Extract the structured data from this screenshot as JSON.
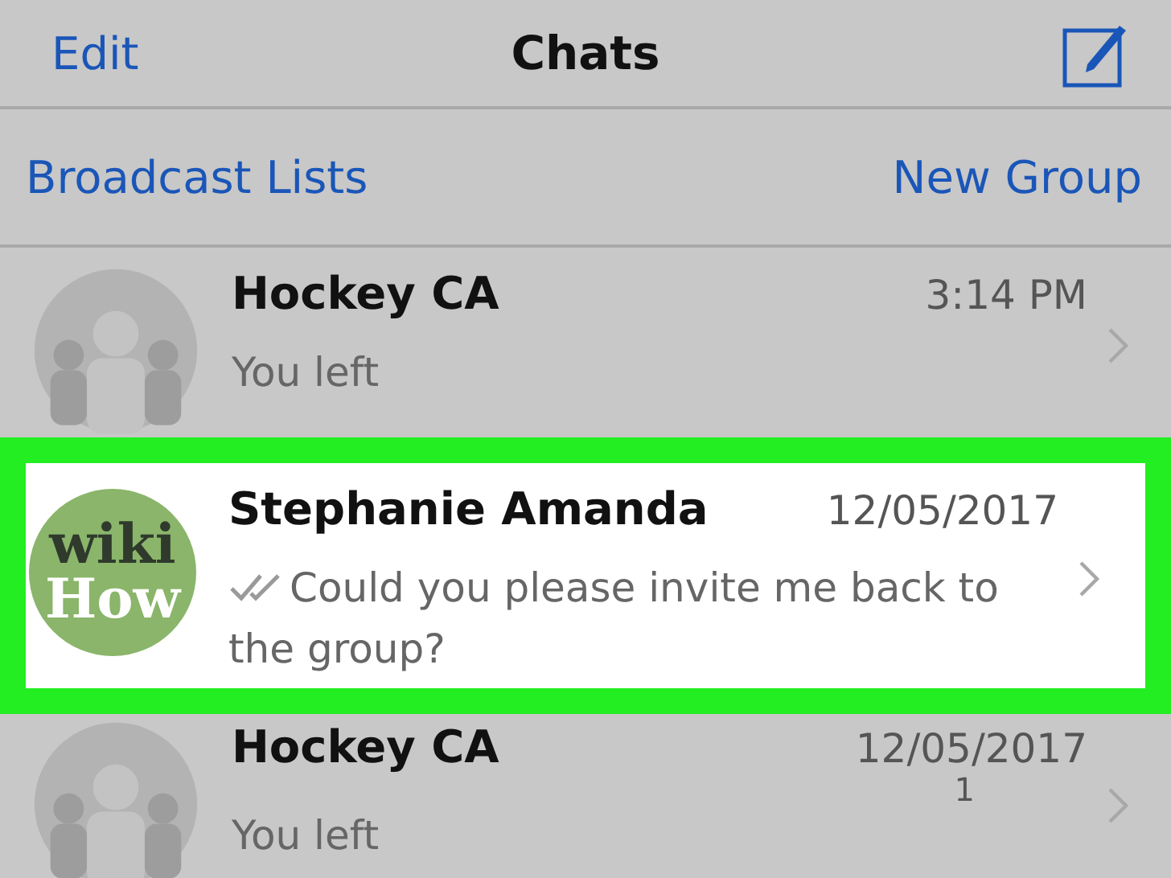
{
  "nav_bar": {
    "left_button": "Edit",
    "title": "Chats"
  },
  "sub_bar": {
    "left_link": "Broadcast Lists",
    "right_link": "New Group"
  },
  "chats": [
    {
      "name": "Hockey CA",
      "time": "3:14 PM",
      "message": "You left",
      "avatar": {
        "kind": "group"
      },
      "read_ticks": false,
      "highlighted": false
    },
    {
      "name": "Stephanie Amanda",
      "time": "12/05/2017",
      "message": "Could you please invite me back to the group?",
      "avatar": {
        "kind": "logo",
        "lines": [
          "wiki",
          "How"
        ]
      },
      "read_ticks": true,
      "highlighted": true
    },
    {
      "name": "Hockey CA",
      "time": "12/05/2017",
      "count": "1",
      "message": "You left",
      "avatar": {
        "kind": "group"
      },
      "read_ticks": false,
      "highlighted": false
    }
  ]
}
